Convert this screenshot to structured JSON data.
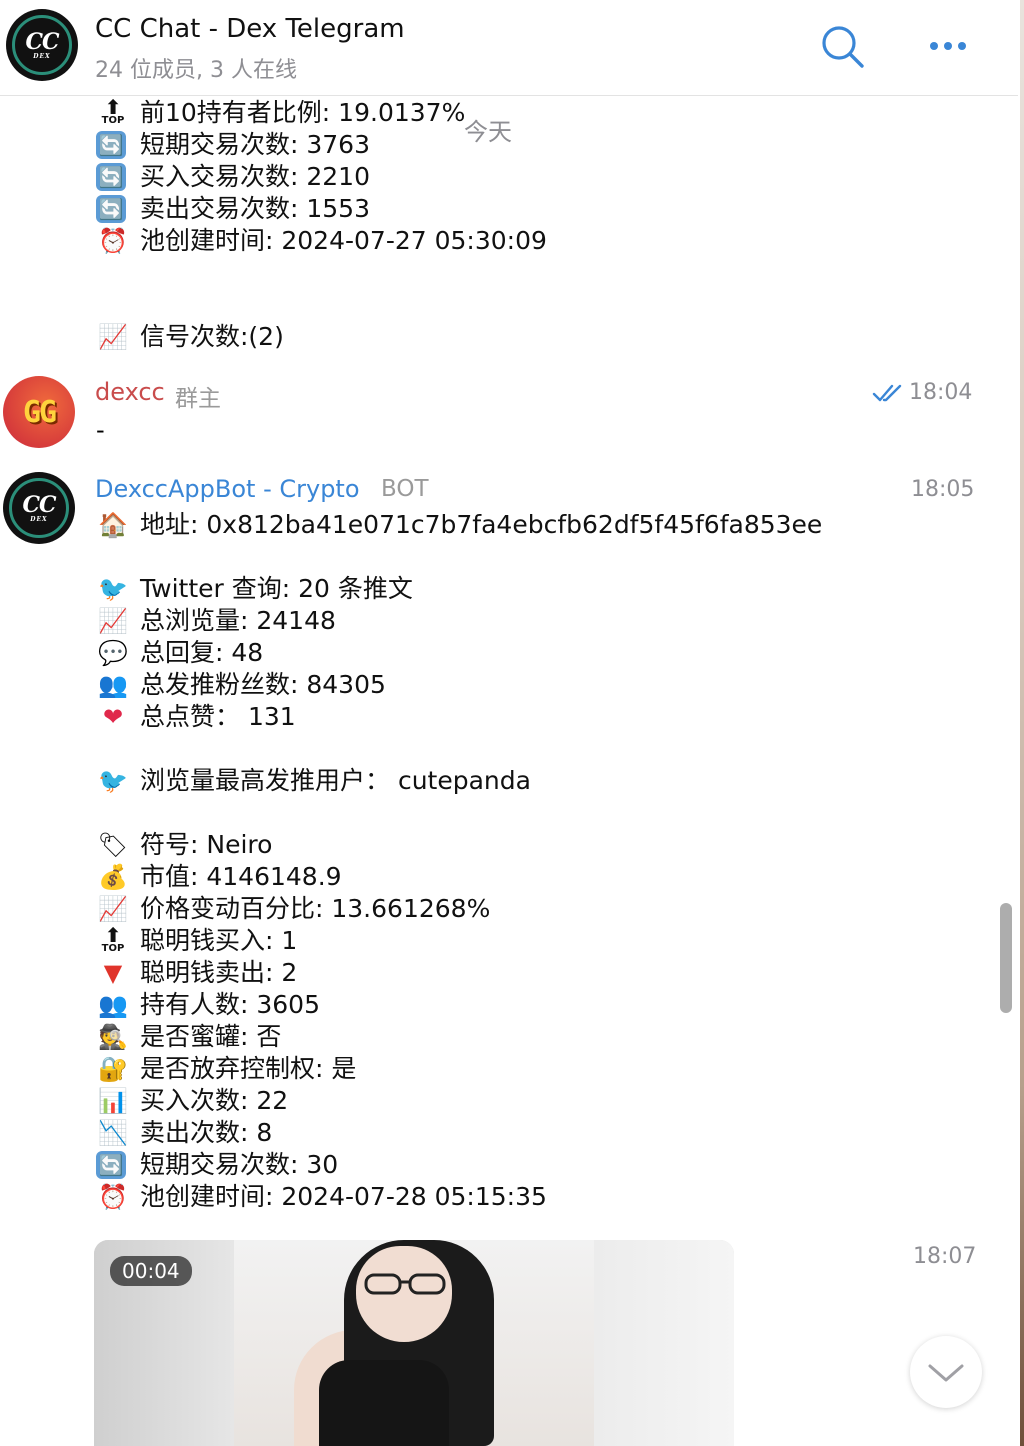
{
  "header": {
    "title": "CC Chat - Dex Telegram",
    "subtitle": "24 位成员, 3 人在线",
    "avatar_text": "CC",
    "avatar_sub": "DEX"
  },
  "date_divider": "今天",
  "prev_message": {
    "lines": [
      {
        "icon": "top-arrow-icon",
        "text": "前10持有者比例: 19.0137%"
      },
      {
        "icon": "refresh-icon",
        "text": "短期交易次数: 3763"
      },
      {
        "icon": "refresh-icon",
        "text": "买入交易次数: 2210"
      },
      {
        "icon": "refresh-icon",
        "text": "卖出交易次数: 1553"
      },
      {
        "icon": "alarm-clock-icon",
        "text": "池创建时间: 2024-07-27 05:30:09"
      },
      {
        "icon": "chart-up-icon",
        "text": "信号次数:(2)"
      }
    ]
  },
  "msg_dexcc": {
    "sender": "dexcc",
    "role": "群主",
    "time": "18:04",
    "text": "-",
    "avatar_text": "GG"
  },
  "msg_bot": {
    "sender": "DexccAppBot - Crypto",
    "role": "BOT",
    "time": "18:05",
    "avatar_text": "CC",
    "avatar_sub": "DEX",
    "lines": [
      {
        "icon": "house-icon",
        "text": "地址: 0x812ba41e071c7b7fa4ebcfb62df5f45f6fa853ee"
      },
      {
        "icon": "bird-icon",
        "text": "Twitter 查询: 20 条推文"
      },
      {
        "icon": "chart-up-icon",
        "text": "总浏览量: 24148"
      },
      {
        "icon": "speech-bubble-icon",
        "text": "总回复: 48"
      },
      {
        "icon": "people-icon",
        "text": "总发推粉丝数: 84305"
      },
      {
        "icon": "heart-icon",
        "text": "总点赞： 131"
      },
      {
        "icon": "bird-icon",
        "text": "浏览量最高发推用户： cutepanda"
      },
      {
        "icon": "label-icon",
        "text": "符号: Neiro"
      },
      {
        "icon": "money-bag-icon",
        "text": "市值: 4146148.9"
      },
      {
        "icon": "chart-up-icon",
        "text": "价格变动百分比: 13.661268%"
      },
      {
        "icon": "top-arrow-icon",
        "text": "聪明钱买入: 1"
      },
      {
        "icon": "red-triangle-down-icon",
        "text": "聪明钱卖出: 2"
      },
      {
        "icon": "people-icon",
        "text": "持有人数: 3605"
      },
      {
        "icon": "detective-icon",
        "text": "是否蜜罐: 否"
      },
      {
        "icon": "lock-key-icon",
        "text": "是否放弃控制权: 是"
      },
      {
        "icon": "bar-chart-icon",
        "text": "买入次数: 22"
      },
      {
        "icon": "chart-down-icon",
        "text": "卖出次数: 8"
      },
      {
        "icon": "refresh-icon",
        "text": "短期交易次数: 30"
      },
      {
        "icon": "alarm-clock-icon",
        "text": "池创建时间: 2024-07-28 05:15:35"
      }
    ]
  },
  "msg_video": {
    "time": "18:07",
    "duration": "00:04"
  },
  "icons": {
    "top": "TOP"
  },
  "colors": {
    "accent": "#3a86d6",
    "sender_dexcc": "#c94c4c",
    "sender_bot": "#3a86d6",
    "meta_gray": "#8e8e93"
  }
}
